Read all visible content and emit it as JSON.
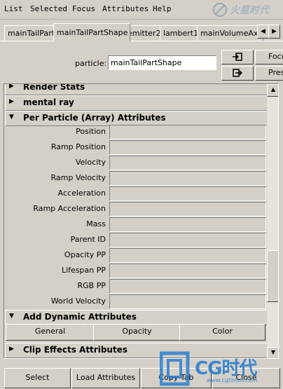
{
  "menu": [
    "List",
    "Selected",
    "Focus",
    "Attributes",
    "Help"
  ],
  "tabs": [
    "mainTailPart",
    "mainTailPartShape",
    "emitter2",
    "lambert1",
    "mainVolumeAxis"
  ],
  "active_tab": "mainTailPartShape",
  "particle": {
    "label": "particle:",
    "value": "mainTailPartShape"
  },
  "side_buttons": {
    "focus": "Focus",
    "presets": "Presets"
  },
  "sections": {
    "render_stats": "Render Stats",
    "mental_ray": "mental ray",
    "per_particle": "Per Particle (Array) Attributes",
    "add_dynamic": "Add Dynamic Attributes",
    "clip_effects": "Clip Effects Attributes"
  },
  "attributes": [
    "Position",
    "Ramp Position",
    "Velocity",
    "Ramp Velocity",
    "Acceleration",
    "Ramp Acceleration",
    "Mass",
    "Parent ID",
    "Opacity PP",
    "Lifespan PP",
    "RGB PP",
    "World Velocity"
  ],
  "dynamic_buttons": [
    "General",
    "Opacity",
    "Color"
  ],
  "bottom_buttons": [
    "Select",
    "Load Attributes",
    "Copy Tab",
    "Close"
  ],
  "watermark": {
    "brand": "CG时代",
    "url": "www.cgtimes.com"
  },
  "colors": {
    "background": "#d4d0c8",
    "watermark": "#2b7fd0"
  }
}
